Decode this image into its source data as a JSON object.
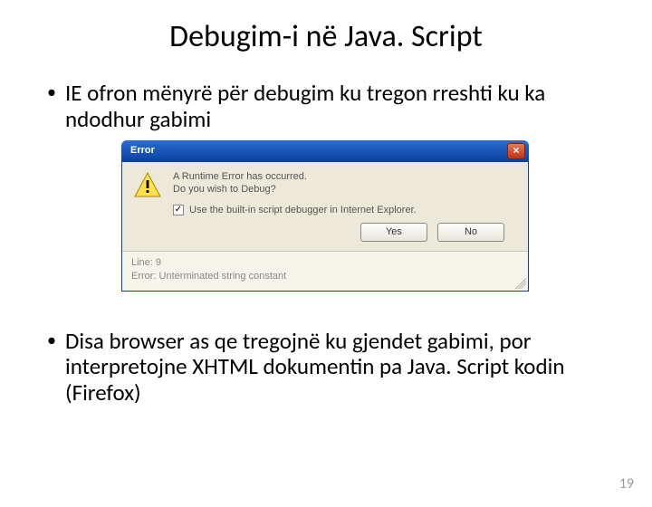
{
  "title": "Debugim-i në Java. Script",
  "bullets": [
    "IE ofron mënyrë për debugim ku tregon rreshti ku ka ndodhur gabimi",
    "Disa browser as qe tregojnë ku gjendet gabimi, por interpretojne XHTML dokumentin pa Java. Script kodin (Firefox)"
  ],
  "page_number": "19",
  "dialog": {
    "title": "Error",
    "close_glyph": "×",
    "message_line1": "A Runtime Error has occurred.",
    "message_line2": "Do you wish to Debug?",
    "checkbox_mark": "✓",
    "checkbox_label": "Use the built-in script debugger in Internet Explorer.",
    "yes_label": "Yes",
    "no_label": "No",
    "detail_line1": "Line: 9",
    "detail_line2": "Error: Unterminated string constant"
  }
}
